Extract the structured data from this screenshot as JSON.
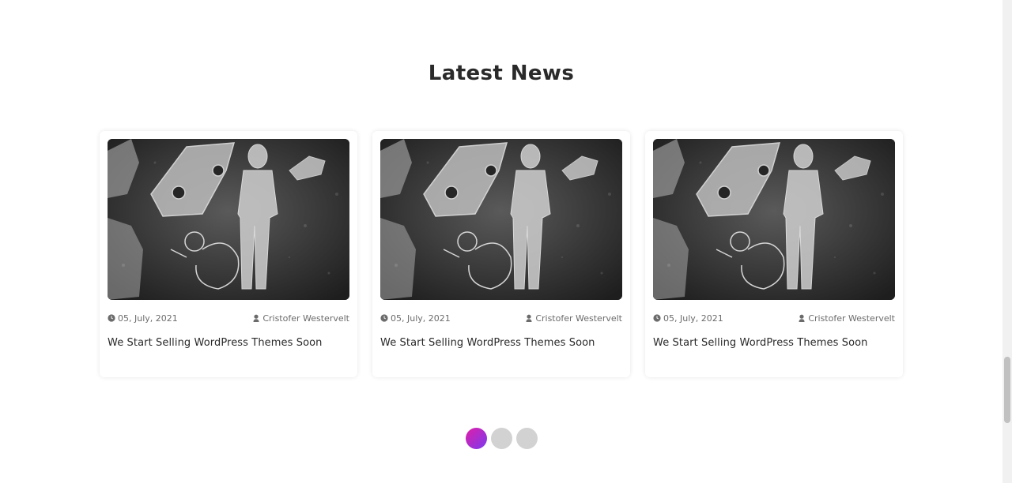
{
  "section": {
    "title": "Latest News"
  },
  "posts": [
    {
      "date": "05, July, 2021",
      "author": "Cristofer Westervelt",
      "title": "We Start Selling WordPress Themes Soon",
      "image_icon": "graffiti-image"
    },
    {
      "date": "05, July, 2021",
      "author": "Cristofer Westervelt",
      "title": "We Start Selling WordPress Themes Soon",
      "image_icon": "graffiti-image"
    },
    {
      "date": "05, July, 2021",
      "author": "Cristofer Westervelt",
      "title": "We Start Selling WordPress Themes Soon",
      "image_icon": "graffiti-image"
    }
  ],
  "pagination": {
    "count": 3,
    "active_index": 0,
    "active_gradient": [
      "#e01ea8",
      "#7a3bf0"
    ],
    "inactive_color": "#d2d2d2"
  },
  "icons": {
    "date": "clock-icon",
    "author": "user-icon"
  }
}
